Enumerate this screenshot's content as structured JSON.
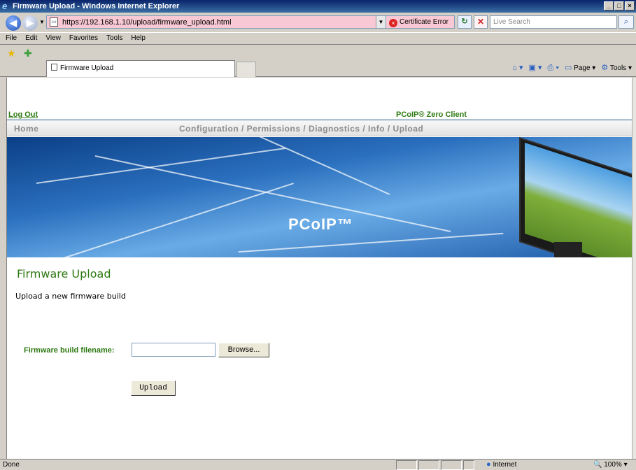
{
  "window": {
    "title": "Firmware Upload - Windows Internet Explorer"
  },
  "address": {
    "url": "https://192.168.1.10/upload/firmware_upload.html",
    "cert_error": "Certificate Error",
    "search_placeholder": "Live Search"
  },
  "menu": [
    "File",
    "Edit",
    "View",
    "Favorites",
    "Tools",
    "Help"
  ],
  "tab": {
    "title": "Firmware Upload"
  },
  "commands": {
    "page": "Page",
    "tools": "Tools"
  },
  "site": {
    "logout": "Log Out",
    "product": "PCoIP® Zero Client",
    "nav_home": "Home",
    "nav_links": "Configuration / Permissions / Diagnostics / Info / Upload",
    "banner_logo": "PCoIP™"
  },
  "page": {
    "heading": "Firmware Upload",
    "description": "Upload a new firmware build",
    "field_label": "Firmware build filename:",
    "field_value": "",
    "browse_label": "Browse...",
    "upload_label": "Upload"
  },
  "status": {
    "text": "Done",
    "zone": "Internet",
    "zoom": "100%"
  }
}
